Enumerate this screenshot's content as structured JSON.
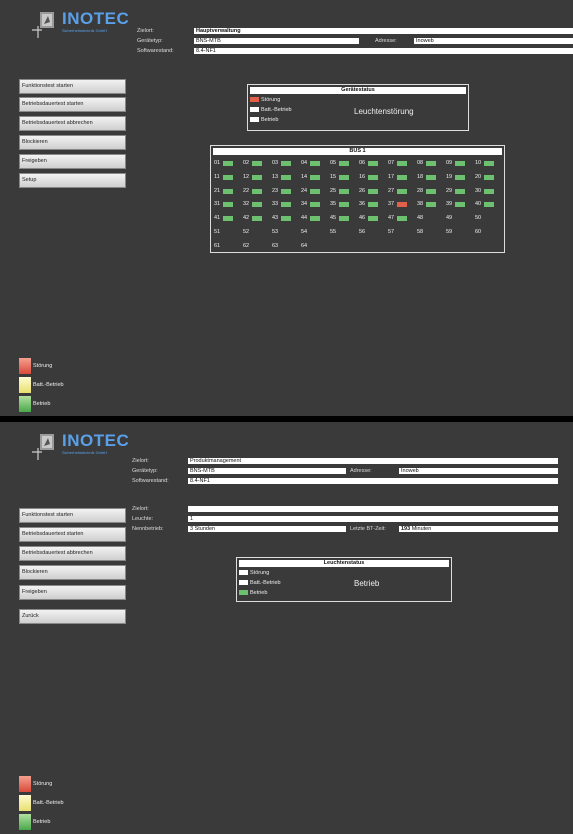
{
  "brand": {
    "name": "INOTEC",
    "tagline": "Sicherheitstechnik GmbH"
  },
  "screen1": {
    "info": {
      "ziel_label": "Zielort:",
      "ziel_value": "Hauptverwaltung",
      "typ_label": "Gerätetyp:",
      "typ_value": "BNS-MTB",
      "adresse_label": "Adresse:",
      "adresse_value": "Inoweb",
      "sw_label": "Softwarestand:",
      "sw_value": "8.4-NF1"
    },
    "menu": [
      "Funktionstest starten",
      "Betriebsdauertest starten",
      "Betriebsdauertest abbrechen",
      "Blockieren",
      "Freigeben",
      "Setup"
    ],
    "legend": [
      {
        "label": "Störung",
        "color": "red"
      },
      {
        "label": "Batt.-Betrieb",
        "color": "yellow"
      },
      {
        "label": "Betrieb",
        "color": "green"
      }
    ],
    "geraetestatus": {
      "title": "Gerätestatus",
      "items": [
        {
          "label": "Störung",
          "state": "red"
        },
        {
          "label": "Batt.-Betrieb",
          "state": "white"
        },
        {
          "label": "Betrieb",
          "state": "white"
        }
      ],
      "status_text": "Leuchtenstörung"
    },
    "bus": {
      "title": "BUS 1",
      "cells": [
        {
          "n": "01",
          "s": "green"
        },
        {
          "n": "02",
          "s": "green"
        },
        {
          "n": "03",
          "s": "green"
        },
        {
          "n": "04",
          "s": "green"
        },
        {
          "n": "05",
          "s": "green"
        },
        {
          "n": "06",
          "s": "green"
        },
        {
          "n": "07",
          "s": "green"
        },
        {
          "n": "08",
          "s": "green"
        },
        {
          "n": "09",
          "s": "green"
        },
        {
          "n": "10",
          "s": "green"
        },
        {
          "n": "11",
          "s": "green"
        },
        {
          "n": "12",
          "s": "green"
        },
        {
          "n": "13",
          "s": "green"
        },
        {
          "n": "14",
          "s": "green"
        },
        {
          "n": "15",
          "s": "green"
        },
        {
          "n": "16",
          "s": "green"
        },
        {
          "n": "17",
          "s": "green"
        },
        {
          "n": "18",
          "s": "green"
        },
        {
          "n": "19",
          "s": "green"
        },
        {
          "n": "20",
          "s": "green"
        },
        {
          "n": "21",
          "s": "green"
        },
        {
          "n": "22",
          "s": "green"
        },
        {
          "n": "23",
          "s": "green"
        },
        {
          "n": "24",
          "s": "green"
        },
        {
          "n": "25",
          "s": "green"
        },
        {
          "n": "26",
          "s": "green"
        },
        {
          "n": "27",
          "s": "green"
        },
        {
          "n": "28",
          "s": "green"
        },
        {
          "n": "29",
          "s": "green"
        },
        {
          "n": "30",
          "s": "green"
        },
        {
          "n": "31",
          "s": "green"
        },
        {
          "n": "32",
          "s": "green"
        },
        {
          "n": "33",
          "s": "green"
        },
        {
          "n": "34",
          "s": "green"
        },
        {
          "n": "35",
          "s": "green"
        },
        {
          "n": "36",
          "s": "green"
        },
        {
          "n": "37",
          "s": "red"
        },
        {
          "n": "38",
          "s": "green"
        },
        {
          "n": "39",
          "s": "green"
        },
        {
          "n": "40",
          "s": "green"
        },
        {
          "n": "41",
          "s": "green"
        },
        {
          "n": "42",
          "s": "green"
        },
        {
          "n": "43",
          "s": "green"
        },
        {
          "n": "44",
          "s": "green"
        },
        {
          "n": "45",
          "s": "green"
        },
        {
          "n": "46",
          "s": "green"
        },
        {
          "n": "47",
          "s": "green"
        },
        {
          "n": "48",
          "s": "none"
        },
        {
          "n": "49",
          "s": "none"
        },
        {
          "n": "50",
          "s": "none"
        },
        {
          "n": "51",
          "s": "none"
        },
        {
          "n": "52",
          "s": "none"
        },
        {
          "n": "53",
          "s": "none"
        },
        {
          "n": "54",
          "s": "none"
        },
        {
          "n": "55",
          "s": "none"
        },
        {
          "n": "56",
          "s": "none"
        },
        {
          "n": "57",
          "s": "none"
        },
        {
          "n": "58",
          "s": "none"
        },
        {
          "n": "59",
          "s": "none"
        },
        {
          "n": "60",
          "s": "none"
        },
        {
          "n": "61",
          "s": "none"
        },
        {
          "n": "62",
          "s": "none"
        },
        {
          "n": "63",
          "s": "none"
        },
        {
          "n": "64",
          "s": "none"
        }
      ]
    }
  },
  "screen2": {
    "info": {
      "ziel_label": "Zielort:",
      "ziel_value": "Produktmanagement",
      "typ_label": "Gerätetyp:",
      "typ_value": "BNS-MTB",
      "adresse_label": "Adresse:",
      "adresse_value": "Inoweb",
      "sw_label": "Softwarestand:",
      "sw_value": "8.4-NF1"
    },
    "detail": {
      "zielort_label": "Zielort:",
      "zielort_value": "",
      "leuchte_label": "Leuchte:",
      "leuchte_value": "1",
      "nennbetrieb_label": "Nennbetrieb:",
      "nennbetrieb_value": "3 Stunden",
      "bt_label": "Letzte BT-Zeit:",
      "bt_value": "193",
      "bt_unit": "Minuten"
    },
    "menu": [
      "Funktionstest starten",
      "Betriebsdauertest starten",
      "Betriebsdauertest abbrechen",
      "Blockieren",
      "Freigeben",
      "Zurück"
    ],
    "legend": [
      {
        "label": "Störung",
        "color": "red"
      },
      {
        "label": "Batt.-Betrieb",
        "color": "yellow"
      },
      {
        "label": "Betrieb",
        "color": "green"
      }
    ],
    "leuchtenstatus": {
      "title": "Leuchtenstatus",
      "items": [
        {
          "label": "Störung",
          "state": "white"
        },
        {
          "label": "Batt.-Betrieb",
          "state": "white"
        },
        {
          "label": "Betrieb",
          "state": "green"
        }
      ],
      "status_text": "Betrieb"
    }
  }
}
